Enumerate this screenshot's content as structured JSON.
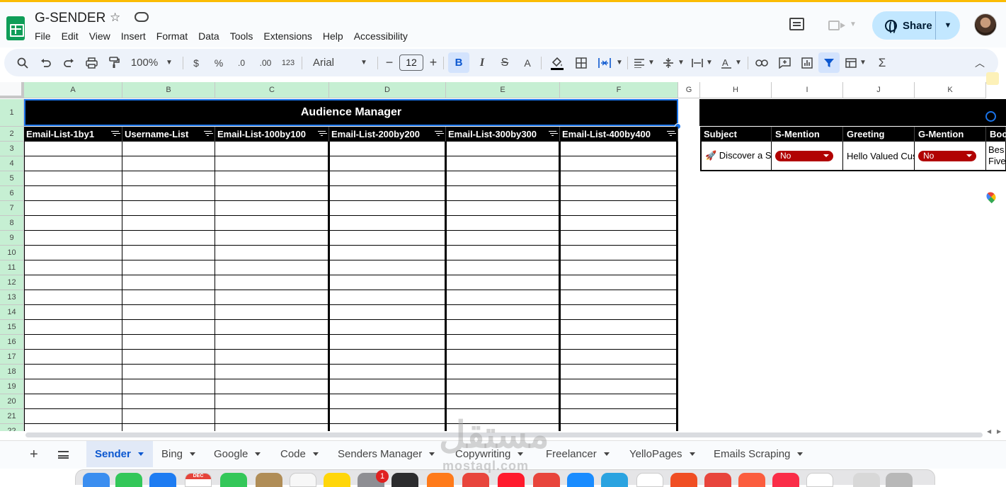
{
  "app": {
    "title": "G-SENDER",
    "menu": [
      "File",
      "Edit",
      "View",
      "Insert",
      "Format",
      "Data",
      "Tools",
      "Extensions",
      "Help",
      "Accessibility"
    ],
    "share_label": "Share",
    "accent_color": "#0f9d58"
  },
  "toolbar": {
    "zoom": "100%",
    "currency": "$",
    "percent": "%",
    "dec_decrease": ".0",
    "dec_increase": ".00",
    "number_format": "123",
    "font": "Arial",
    "font_size": "12",
    "bold": "B",
    "italic": "I",
    "strike": "S",
    "text_color": "A",
    "sum": "Σ"
  },
  "grid": {
    "columns": [
      "A",
      "B",
      "C",
      "D",
      "E",
      "F",
      "G",
      "H",
      "I",
      "J",
      "K"
    ],
    "rows": [
      "1",
      "2",
      "3",
      "4",
      "5",
      "6",
      "7",
      "8",
      "9",
      "10",
      "11",
      "12",
      "13",
      "14",
      "15",
      "16",
      "17",
      "18",
      "19",
      "20",
      "21",
      "22"
    ],
    "banner": "Audience Manager",
    "headers": [
      "Email-List-1by1",
      "Username-List",
      "Email-List-100by100",
      "Email-List-200by200",
      "Email-List-300by300",
      "Email-List-400by400"
    ],
    "right_headers": [
      "Subject",
      "S-Mention",
      "Greeting",
      "G-Mention",
      "Boo"
    ],
    "right_row": {
      "subject": "🚀 Discover a S",
      "s_mention": "No",
      "greeting": "Hello Valued Cus",
      "g_mention": "No",
      "body": "Bes\nFive"
    },
    "status_color": "#b10202"
  },
  "sheets": {
    "tabs": [
      "Sender",
      "Bing",
      "Google",
      "Code",
      "Senders Manager",
      "Copywriting",
      "Freelancer",
      "YelloPages",
      "Emails Scraping"
    ],
    "active": "Sender"
  },
  "dock": {
    "calendar_month": "DEC",
    "badge": "1"
  },
  "watermark": {
    "arabic": "مستقل",
    "latin": "mostaql.com"
  }
}
